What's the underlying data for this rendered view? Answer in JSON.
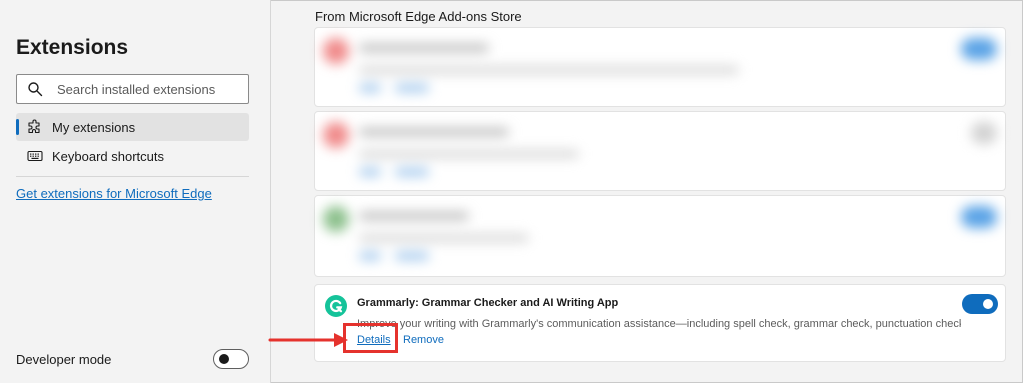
{
  "sidebar": {
    "title": "Extensions",
    "search_placeholder": "Search installed extensions",
    "items": [
      {
        "label": "My extensions",
        "icon": "puzzle-icon",
        "active": true
      },
      {
        "label": "Keyboard shortcuts",
        "icon": "keyboard-icon",
        "active": false
      }
    ],
    "get_extensions_link": "Get extensions for Microsoft Edge",
    "developer_mode_label": "Developer mode",
    "developer_mode_enabled": false
  },
  "main": {
    "section_title": "From Microsoft Edge Add-ons Store",
    "extension": {
      "name": "Grammarly: Grammar Checker and AI Writing App",
      "description": "Improve your writing with Grammarly's communication assistance—including spell check, grammar check, punctuation check, a...",
      "enabled": true,
      "details_label": "Details",
      "remove_label": "Remove",
      "icon": "grammarly-logo"
    }
  },
  "annotation": {
    "highlight_color": "#e5322d",
    "target": "Details"
  },
  "colors": {
    "accent": "#0f6cbd",
    "grammarly_green": "#15c39a"
  }
}
